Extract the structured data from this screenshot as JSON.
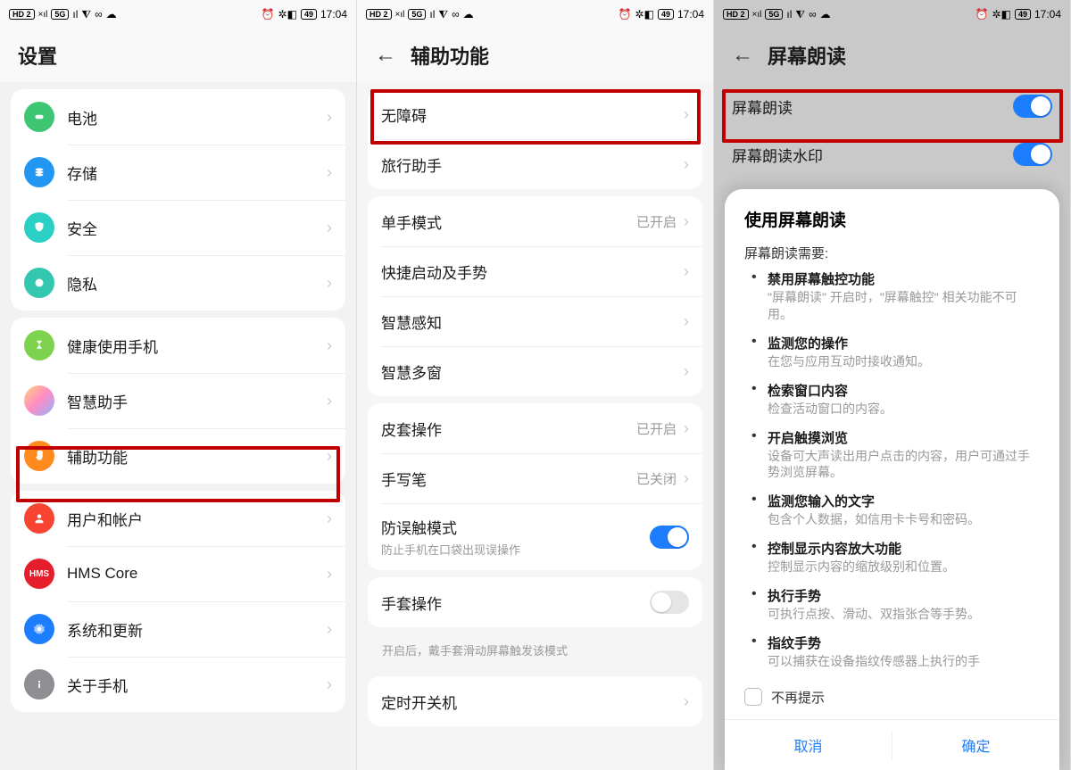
{
  "status": {
    "hd": "HD 2",
    "net": "5G",
    "wifi": "📶",
    "infinity": "∞",
    "chat": "💬",
    "alarm": "⏰",
    "bt": "✱",
    "batt": "49",
    "time": "17:04"
  },
  "screen1": {
    "title": "设置",
    "items": [
      {
        "label": "电池"
      },
      {
        "label": "存储"
      },
      {
        "label": "安全"
      },
      {
        "label": "隐私"
      },
      {
        "label": "健康使用手机"
      },
      {
        "label": "智慧助手"
      },
      {
        "label": "辅助功能"
      },
      {
        "label": "用户和帐户"
      },
      {
        "label": "HMS Core"
      },
      {
        "label": "系统和更新"
      },
      {
        "label": "关于手机"
      }
    ]
  },
  "screen2": {
    "title": "辅助功能",
    "group1": [
      {
        "label": "无障碍"
      },
      {
        "label": "旅行助手"
      }
    ],
    "group2": [
      {
        "label": "单手模式",
        "value": "已开启"
      },
      {
        "label": "快捷启动及手势"
      },
      {
        "label": "智慧感知"
      },
      {
        "label": "智慧多窗"
      }
    ],
    "group3": [
      {
        "label": "皮套操作",
        "value": "已开启"
      },
      {
        "label": "手写笔",
        "value": "已关闭"
      },
      {
        "label": "防误触模式",
        "sub": "防止手机在口袋出现误操作",
        "toggle": true
      }
    ],
    "group4": [
      {
        "label": "手套操作",
        "toggle": false
      }
    ],
    "group4_hint": "开启后，戴手套滑动屏幕触发该模式",
    "group5": [
      {
        "label": "定时开关机"
      }
    ]
  },
  "screen3": {
    "title": "屏幕朗读",
    "rows": [
      {
        "label": "屏幕朗读",
        "toggle": true
      },
      {
        "label": "屏幕朗读水印",
        "toggle": true
      }
    ],
    "modal": {
      "title": "使用屏幕朗读",
      "intro": "屏幕朗读需要:",
      "items": [
        {
          "t": "禁用屏幕触控功能",
          "d": "\"屏幕朗读\" 开启时，\"屏幕触控\" 相关功能不可用。"
        },
        {
          "t": "监测您的操作",
          "d": "在您与应用互动时接收通知。"
        },
        {
          "t": "检索窗口内容",
          "d": "检查活动窗口的内容。"
        },
        {
          "t": "开启触摸浏览",
          "d": "设备可大声读出用户点击的内容，用户可通过手势浏览屏幕。"
        },
        {
          "t": "监测您输入的文字",
          "d": "包含个人数据，如信用卡卡号和密码。"
        },
        {
          "t": "控制显示内容放大功能",
          "d": "控制显示内容的缩放级别和位置。"
        },
        {
          "t": "执行手势",
          "d": "可执行点按、滑动、双指张合等手势。"
        },
        {
          "t": "指纹手势",
          "d": "可以捕获在设备指纹传感器上执行的手"
        }
      ],
      "dont_show": "不再提示",
      "cancel": "取消",
      "confirm": "确定"
    }
  }
}
